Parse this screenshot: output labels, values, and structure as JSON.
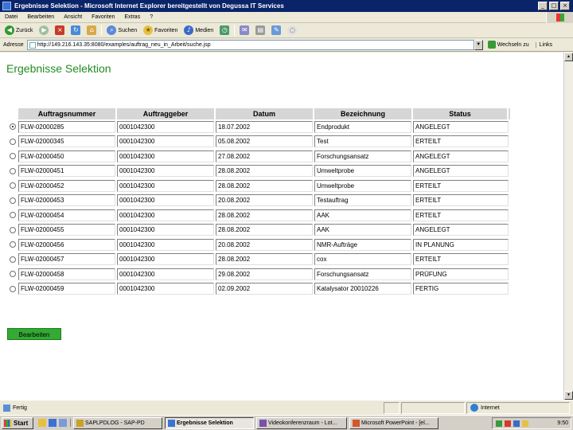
{
  "window": {
    "title": "Ergebnisse Selektion - Microsoft Internet Explorer bereitgestellt von Degussa IT Services"
  },
  "menu": [
    "Datei",
    "Bearbeiten",
    "Ansicht",
    "Favoriten",
    "Extras",
    "?"
  ],
  "toolbar": {
    "back_label": "Zurück",
    "search_label": "Suchen",
    "favorites_label": "Favoriten",
    "media_label": "Medien"
  },
  "address": {
    "label": "Adresse",
    "value": "http://149.216.143.35:8080/examples/auftrag_neu_in_Arbeit/suche.jsp",
    "go_label": "Wechseln zu",
    "links_label": "Links"
  },
  "page": {
    "title": "Ergebnisse Selektion",
    "columns": [
      "Auftragsnummer",
      "Auftraggeber",
      "Datum",
      "Bezeichnung",
      "Status"
    ],
    "rows": [
      {
        "nr": "FLW-02000285",
        "auftraggeber": "0001042300",
        "datum": "18.07.2002",
        "bezeichnung": "Endprodukt",
        "status": "ANGELEGT",
        "selected": true
      },
      {
        "nr": "FLW-02000345",
        "auftraggeber": "0001042300",
        "datum": "05.08.2002",
        "bezeichnung": "Test",
        "status": "ERTEILT",
        "selected": false
      },
      {
        "nr": "FLW-02000450",
        "auftraggeber": "0001042300",
        "datum": "27.08.2002",
        "bezeichnung": "Forschungsansatz",
        "status": "ANGELEGT",
        "selected": false
      },
      {
        "nr": "FLW-02000451",
        "auftraggeber": "0001042300",
        "datum": "28.08.2002",
        "bezeichnung": "Umweltprobe",
        "status": "ANGELEGT",
        "selected": false
      },
      {
        "nr": "FLW-02000452",
        "auftraggeber": "0001042300",
        "datum": "28.08.2002",
        "bezeichnung": "Umweltprobe",
        "status": "ERTEILT",
        "selected": false
      },
      {
        "nr": "FLW-02000453",
        "auftraggeber": "0001042300",
        "datum": "20.08.2002",
        "bezeichnung": "Testauftrag",
        "status": "ERTEILT",
        "selected": false
      },
      {
        "nr": "FLW-02000454",
        "auftraggeber": "0001042300",
        "datum": "28.08.2002",
        "bezeichnung": "AAK",
        "status": "ERTEILT",
        "selected": false
      },
      {
        "nr": "FLW-02000455",
        "auftraggeber": "0001042300",
        "datum": "28.08.2002",
        "bezeichnung": "AAK",
        "status": "ANGELEGT",
        "selected": false
      },
      {
        "nr": "FLW-02000456",
        "auftraggeber": "0001042300",
        "datum": "20.08.2002",
        "bezeichnung": "NMR-Aufträge",
        "status": "IN PLANUNG",
        "selected": false
      },
      {
        "nr": "FLW-02000457",
        "auftraggeber": "0001042300",
        "datum": "28.08.2002",
        "bezeichnung": "cox",
        "status": "ERTEILT",
        "selected": false
      },
      {
        "nr": "FLW-02000458",
        "auftraggeber": "0001042300",
        "datum": "29.08.2002",
        "bezeichnung": "Forschungsansatz",
        "status": "PRÜFUNG",
        "selected": false
      },
      {
        "nr": "FLW-02000459",
        "auftraggeber": "0001042300",
        "datum": "02.09.2002",
        "bezeichnung": "Katalysator 20010226",
        "status": "FERTIG",
        "selected": false
      }
    ],
    "button_label": "Bearbeiten"
  },
  "statusbar": {
    "text": "Fertig",
    "zone": "Internet"
  },
  "taskbar": {
    "start": "Start",
    "tasks": [
      {
        "label": "SAPLPDLOG - SAP-PD",
        "active": false,
        "color": "#c9a227"
      },
      {
        "label": "Ergebnisse Selektion",
        "active": true,
        "color": "#3b72d6"
      },
      {
        "label": "Videokonferenzraum - Lot...",
        "active": false,
        "color": "#7a4fb0"
      },
      {
        "label": "Microsoft PowerPoint - [el...",
        "active": false,
        "color": "#d2572a"
      }
    ],
    "clock": "9:50"
  }
}
